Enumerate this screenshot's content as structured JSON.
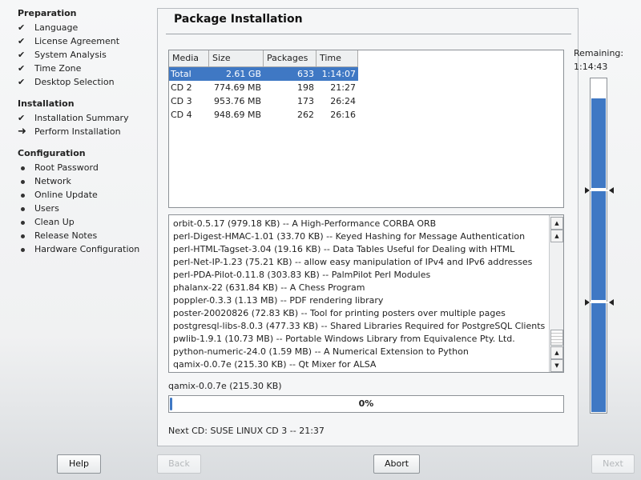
{
  "sidebar": {
    "sections": [
      {
        "title": "Preparation",
        "steps": [
          {
            "label": "Language",
            "state": "done"
          },
          {
            "label": "License Agreement",
            "state": "done"
          },
          {
            "label": "System Analysis",
            "state": "done"
          },
          {
            "label": "Time Zone",
            "state": "done"
          },
          {
            "label": "Desktop Selection",
            "state": "done"
          }
        ]
      },
      {
        "title": "Installation",
        "steps": [
          {
            "label": "Installation Summary",
            "state": "done"
          },
          {
            "label": "Perform Installation",
            "state": "current"
          }
        ]
      },
      {
        "title": "Configuration",
        "steps": [
          {
            "label": "Root Password",
            "state": "pending"
          },
          {
            "label": "Network",
            "state": "pending"
          },
          {
            "label": "Online Update",
            "state": "pending"
          },
          {
            "label": "Users",
            "state": "pending"
          },
          {
            "label": "Clean Up",
            "state": "pending"
          },
          {
            "label": "Release Notes",
            "state": "pending"
          },
          {
            "label": "Hardware Configuration",
            "state": "pending"
          }
        ]
      }
    ],
    "icons": {
      "done": "checkmark-icon",
      "current": "arrow-right-icon",
      "pending": "bullet-icon"
    }
  },
  "main": {
    "title": "Package Installation",
    "media_table": {
      "columns": [
        "Media",
        "Size",
        "Packages",
        "Time"
      ],
      "rows": [
        {
          "media": "Total",
          "size": "2.61 GB",
          "packages": "633",
          "time": "1:14:07",
          "selected": true
        },
        {
          "media": "CD 2",
          "size": "774.69 MB",
          "packages": "198",
          "time": "21:27",
          "selected": false
        },
        {
          "media": "CD 3",
          "size": "953.76 MB",
          "packages": "173",
          "time": "26:24",
          "selected": false
        },
        {
          "media": "CD 4",
          "size": "948.69 MB",
          "packages": "262",
          "time": "26:16",
          "selected": false
        }
      ]
    },
    "package_log": [
      "orbit-0.5.17 (979.18 KB) -- A High-Performance CORBA ORB",
      "perl-Digest-HMAC-1.01 (33.70 KB) -- Keyed Hashing for Message Authentication",
      "perl-HTML-Tagset-3.04 (19.16 KB) -- Data Tables Useful for Dealing with HTML",
      "perl-Net-IP-1.23 (75.21 KB) -- allow easy manipulation of IPv4 and IPv6 addresses",
      "perl-PDA-Pilot-0.11.8 (303.83 KB) -- PalmPilot Perl Modules",
      "phalanx-22 (631.84 KB) -- A Chess Program",
      "poppler-0.3.3 (1.13 MB) -- PDF rendering library",
      "poster-20020826 (72.83 KB) -- Tool for printing posters over multiple pages",
      "postgresql-libs-8.0.3 (477.33 KB) -- Shared Libraries Required for PostgreSQL Clients",
      "pwlib-1.9.1 (10.73 MB) -- Portable Windows Library from Equivalence Pty. Ltd.",
      "python-numeric-24.0 (1.59 MB) -- A Numerical Extension to Python",
      "qamix-0.0.7e (215.30 KB) -- Qt Mixer for ALSA"
    ],
    "current_package": "qamix-0.0.7e (215.30 KB)",
    "package_progress": {
      "percent": 0,
      "label": "0%"
    },
    "next_cd": "Next CD: SUSE LINUX CD 3 -- 21:37"
  },
  "remaining": {
    "label": "Remaining:",
    "value": "1:14:43",
    "fraction_complete": 0.06
  },
  "buttons": {
    "help": "Help",
    "back": "Back",
    "abort": "Abort",
    "next": "Next"
  },
  "colors": {
    "accent": "#3f78c4"
  }
}
